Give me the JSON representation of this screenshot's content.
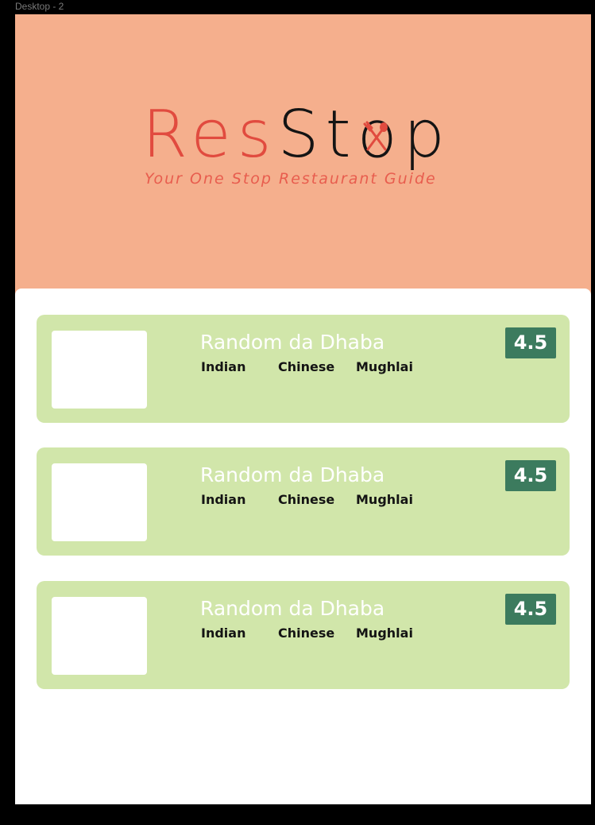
{
  "frame_label": "Desktop - 2",
  "logo": {
    "part1": "Res",
    "part2_before": "St",
    "part2_o": "o",
    "part2_after": "p",
    "tagline": "Your One Stop Restaurant Guide",
    "icon": "fork-spoon-icon"
  },
  "colors": {
    "hero_bg": "#f5af8d",
    "brand_red": "#e14b3f",
    "card_bg": "#d1e6aa",
    "rating_bg": "#3c7b5e"
  },
  "restaurants": [
    {
      "name": "Random da Dhaba",
      "tags": [
        "Indian",
        "Chinese",
        "Mughlai"
      ],
      "rating": "4.5"
    },
    {
      "name": "Random da Dhaba",
      "tags": [
        "Indian",
        "Chinese",
        "Mughlai"
      ],
      "rating": "4.5"
    },
    {
      "name": "Random da Dhaba",
      "tags": [
        "Indian",
        "Chinese",
        "Mughlai"
      ],
      "rating": "4.5"
    }
  ]
}
